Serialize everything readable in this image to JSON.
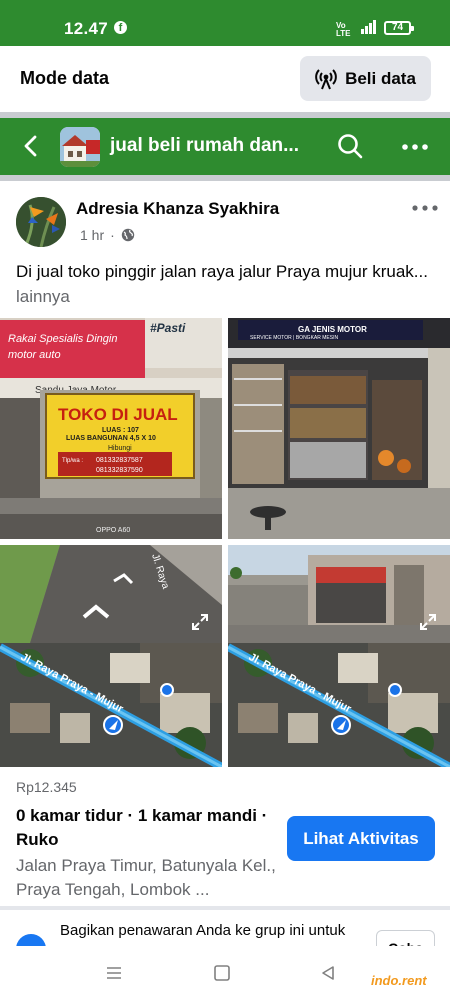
{
  "status_bar": {
    "time": "12.47",
    "network": "4G",
    "volte": "Vo LTE",
    "battery": "74"
  },
  "data_bar": {
    "title": "Mode data",
    "buy_label": "Beli data"
  },
  "group": {
    "title": "jual beli rumah dan...",
    "thumb_text": "RUMAH DIJUAL"
  },
  "post": {
    "author": "Adresia Khanza Syakhira",
    "time": "1 hr",
    "privacy_icon": "globe-icon",
    "text": "Di jual toko pinggir jalan raya jalur Praya mujur kruak...",
    "more": "lainnya"
  },
  "photos": {
    "sign_top": "Rakai Spesialis Dingin",
    "sign_sub": "motor auto",
    "sign_pasti": "#Pasti",
    "sign_shop": "Sandu Jaya Motor",
    "for_sale_title": "TOKO DI JUAL",
    "luas": "LUAS : 107",
    "luas_bangunan": "LUAS BANGUNAN 4,5 X 10",
    "hubungi": "Hibungi",
    "phone1": "081332837587",
    "phone2": "081332837590",
    "tlp_label": "Tlp/wa :",
    "camera": "OPPO A60",
    "shop_banner": "GA JENIS MOTOR",
    "shop_banner2": "SERVICE MOTOR | BONGKAR MESIN",
    "street_name": "Jl. Raya Praya - Mujur",
    "street_short": "Jl. Raya",
    "map_label": "Jl. Raya Praya - Mujur",
    "expand_icon": "expand-icon"
  },
  "listing": {
    "price": "Rp12.345",
    "rooms": "0 kamar tidur · 1 kamar mandi · Ruko",
    "address": "Jalan Praya Timur, Batunyala Kel., Praya Tengah, Lombok ...",
    "activity_button": "Lihat Aktivitas"
  },
  "share": {
    "text": "Bagikan penawaran Anda ke grup ini untuk menjangkau lebih banyak orang",
    "button": "Coba"
  },
  "navbar": {
    "menu_icon": "recents-icon",
    "home_icon": "home-icon",
    "back_icon": "back-triangle-icon"
  },
  "watermark": "indo.rent",
  "colors": {
    "green": "#2e8b2f",
    "blue": "#1877f2",
    "grey_text": "#65676b"
  }
}
